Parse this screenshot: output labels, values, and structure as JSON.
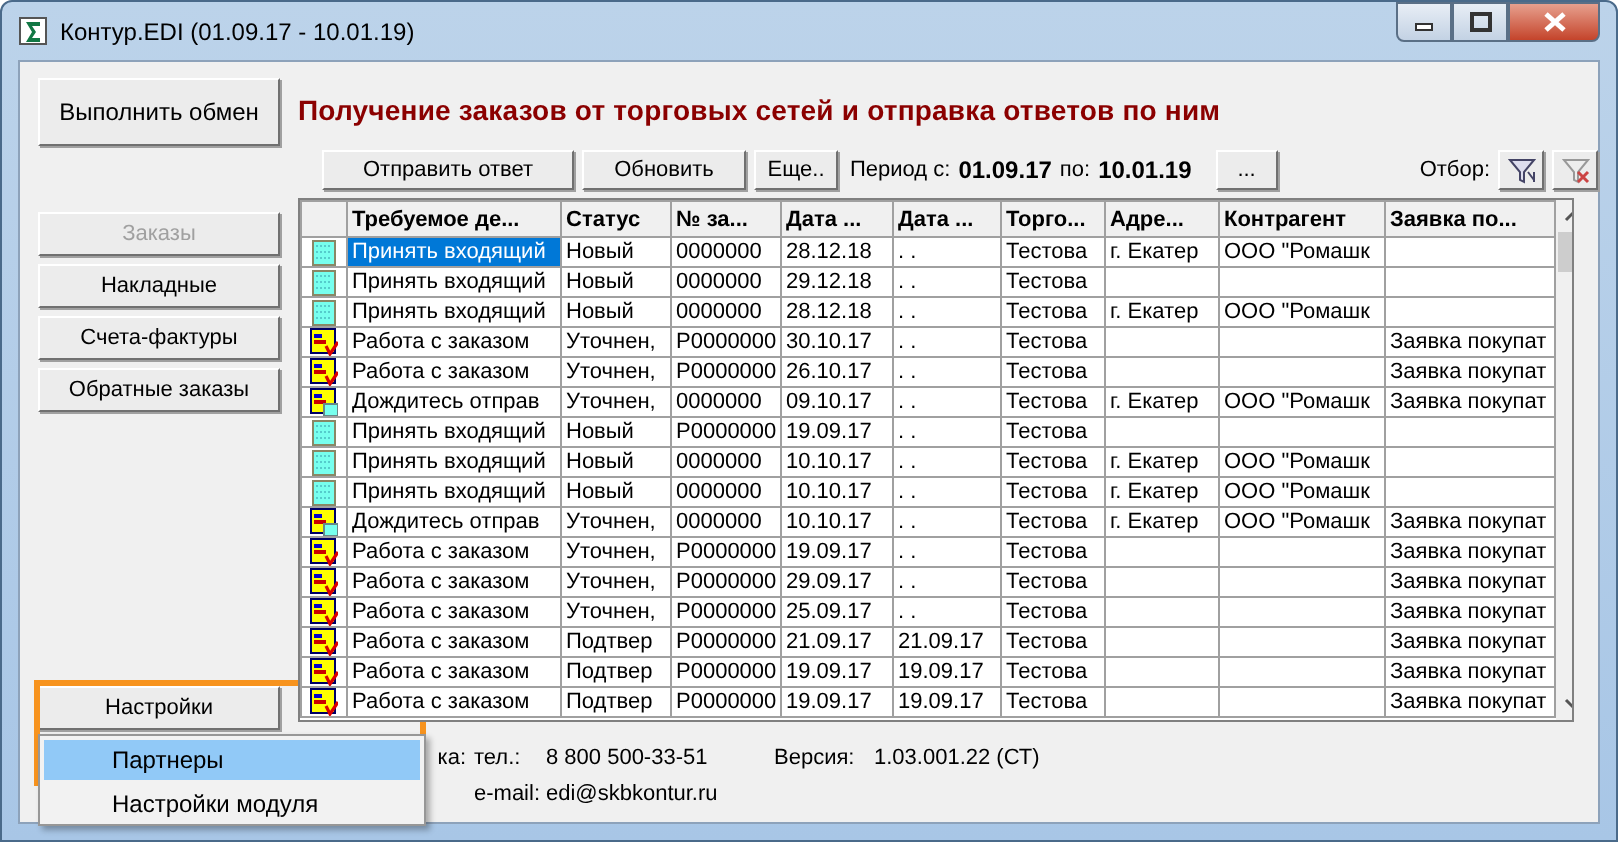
{
  "window": {
    "title": "Контур.EDI (01.09.17 - 10.01.19)"
  },
  "exchange_button": "Выполнить обмен",
  "heading": "Получение заказов от торговых сетей и отправка ответов по ним",
  "nav": [
    {
      "label": "Заказы",
      "disabled": true
    },
    {
      "label": "Накладные",
      "disabled": false
    },
    {
      "label": "Счета-фактуры",
      "disabled": false
    },
    {
      "label": "Обратные заказы",
      "disabled": false
    }
  ],
  "settings_button": "Настройки",
  "settings_menu": [
    {
      "label": "Партнеры",
      "selected": true
    },
    {
      "label": "Настройки модуля",
      "selected": false
    }
  ],
  "toolbar": {
    "buttons": [
      "Отправить ответ",
      "Обновить",
      "Еще.."
    ],
    "period_label": "Период с:",
    "period_from": "01.09.17",
    "period_to_label": "по:",
    "period_to": "10.01.19",
    "period_button": "...",
    "filter_label": "Отбор:"
  },
  "table": {
    "columns": [
      "Требуемое де...",
      "Статус",
      "№ за...",
      "Дата ...",
      "Дата ...",
      "Торго...",
      "Адре...",
      "Контрагент",
      "Заявка по..."
    ],
    "rows": [
      {
        "kind": "new",
        "selected": true,
        "cells": [
          "Принять входящий",
          "Новый",
          "0000000",
          "28.12.18",
          ". .",
          "Тестова",
          "г. Екатер",
          "ООО \"Ромашк",
          null
        ]
      },
      {
        "kind": "new",
        "selected": false,
        "cells": [
          "Принять входящий",
          "Новый",
          "0000000",
          "29.12.18",
          ". .",
          "Тестова",
          null,
          null,
          null
        ]
      },
      {
        "kind": "new",
        "selected": false,
        "cells": [
          "Принять входящий",
          "Новый",
          "0000000",
          "28.12.18",
          ". .",
          "Тестова",
          "г. Екатер",
          "ООО \"Ромашк",
          null
        ]
      },
      {
        "kind": "work",
        "selected": false,
        "cells": [
          "Работа с заказом",
          "Уточнен,",
          "P0000000",
          "30.10.17",
          ". .",
          "Тестова",
          null,
          null,
          "Заявка покупат"
        ]
      },
      {
        "kind": "work",
        "selected": false,
        "cells": [
          "Работа с заказом",
          "Уточнен,",
          "P0000000",
          "26.10.17",
          ". .",
          "Тестова",
          null,
          null,
          "Заявка покупат"
        ]
      },
      {
        "kind": "wait",
        "selected": false,
        "cells": [
          "Дождитесь отправ",
          "Уточнен,",
          "0000000",
          "09.10.17",
          ". .",
          "Тестова",
          "г. Екатер",
          "ООО \"Ромашк",
          "Заявка покупат"
        ]
      },
      {
        "kind": "new",
        "selected": false,
        "cells": [
          "Принять входящий",
          "Новый",
          "P0000000",
          "19.09.17",
          ". .",
          "Тестова",
          null,
          null,
          null
        ]
      },
      {
        "kind": "new",
        "selected": false,
        "cells": [
          "Принять входящий",
          "Новый",
          "0000000",
          "10.10.17",
          ". .",
          "Тестова",
          "г. Екатер",
          "ООО \"Ромашк",
          null
        ]
      },
      {
        "kind": "new",
        "selected": false,
        "cells": [
          "Принять входящий",
          "Новый",
          "0000000",
          "10.10.17",
          ". .",
          "Тестова",
          "г. Екатер",
          "ООО \"Ромашк",
          null
        ]
      },
      {
        "kind": "wait",
        "selected": false,
        "cells": [
          "Дождитесь отправ",
          "Уточнен,",
          "0000000",
          "10.10.17",
          ". .",
          "Тестова",
          "г. Екатер",
          "ООО \"Ромашк",
          "Заявка покупат"
        ]
      },
      {
        "kind": "work",
        "selected": false,
        "cells": [
          "Работа с заказом",
          "Уточнен,",
          "P0000000",
          "19.09.17",
          ". .",
          "Тестова",
          null,
          null,
          "Заявка покупат"
        ]
      },
      {
        "kind": "work",
        "selected": false,
        "cells": [
          "Работа с заказом",
          "Уточнен,",
          "P0000000",
          "29.09.17",
          ". .",
          "Тестова",
          null,
          null,
          "Заявка покупат"
        ]
      },
      {
        "kind": "work",
        "selected": false,
        "cells": [
          "Работа с заказом",
          "Уточнен,",
          "P0000000",
          "25.09.17",
          ". .",
          "Тестова",
          null,
          null,
          "Заявка покупат"
        ]
      },
      {
        "kind": "work",
        "selected": false,
        "cells": [
          "Работа с заказом",
          "Подтвер",
          "P0000000",
          "21.09.17",
          "21.09.17",
          "Тестова",
          null,
          null,
          "Заявка покупат"
        ]
      },
      {
        "kind": "work",
        "selected": false,
        "cells": [
          "Работа с заказом",
          "Подтвер",
          "P0000000",
          "19.09.17",
          "19.09.17",
          "Тестова",
          null,
          null,
          "Заявка покупат"
        ]
      },
      {
        "kind": "work",
        "selected": false,
        "cells": [
          "Работа с заказом",
          "Подтвер",
          "P0000000",
          "19.09.17",
          "19.09.17",
          "Тестова",
          null,
          null,
          "Заявка покупат"
        ]
      }
    ]
  },
  "footer": {
    "support_label": "ка:",
    "phone_label": "тел.:",
    "phone": "8 800 500-33-51",
    "version_label": "Версия:",
    "version": "1.03.001.22 (СТ)",
    "email_label": "e-mail:",
    "email": "edi@skbkontur.ru"
  }
}
